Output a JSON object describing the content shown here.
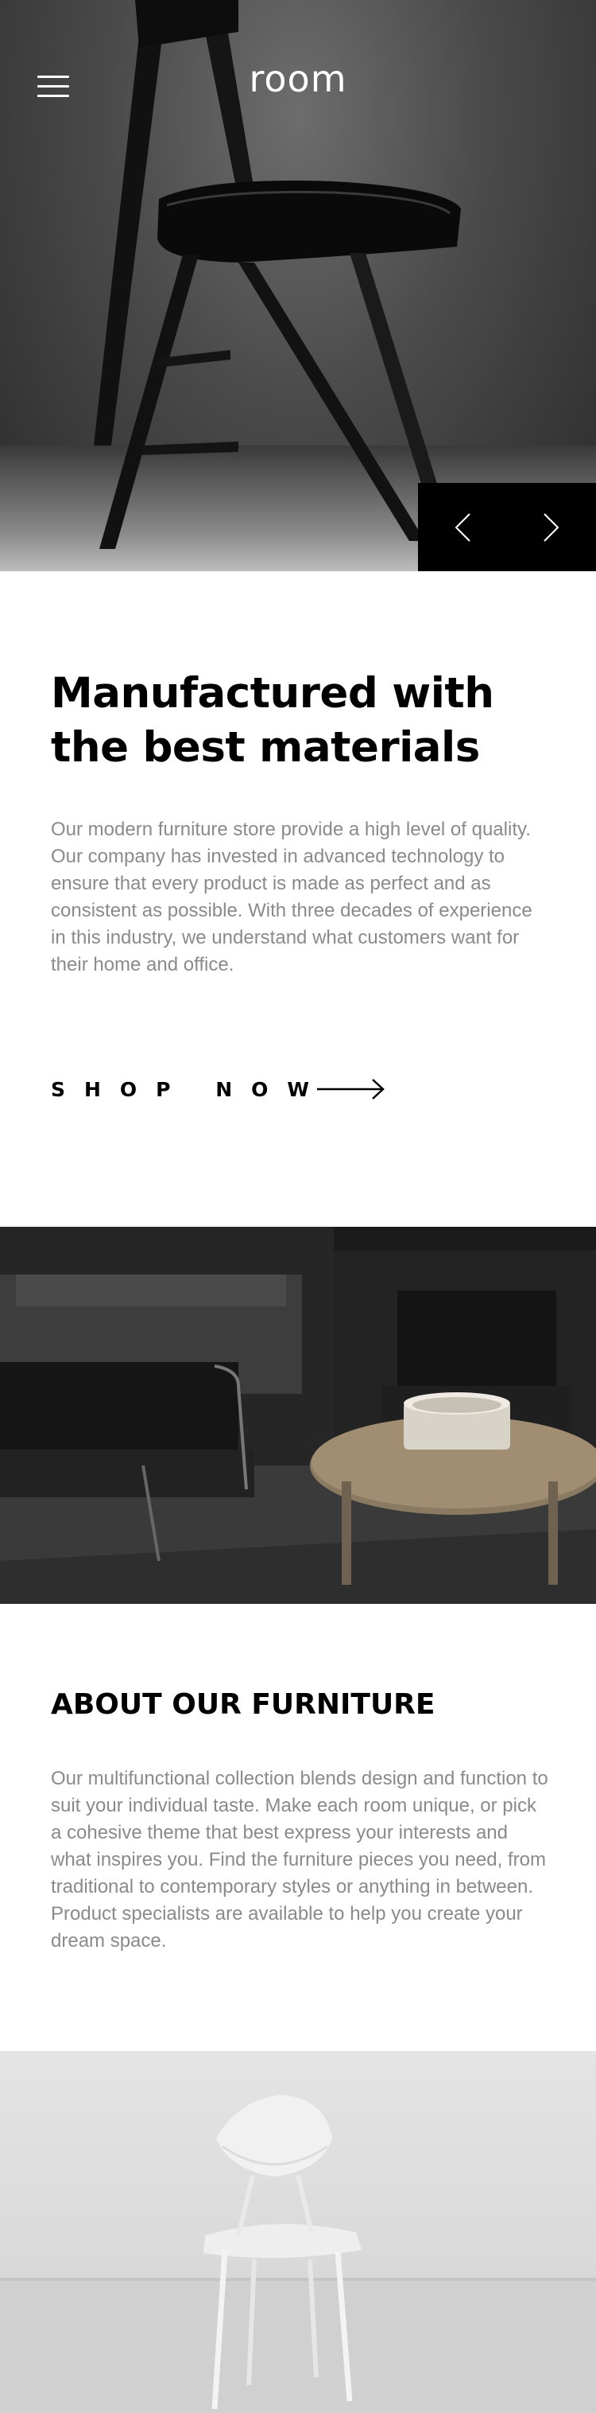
{
  "header": {
    "logo": "room",
    "menu_icon": "hamburger-menu-icon"
  },
  "hero": {
    "image_alt": "black folding chair",
    "prev_icon": "chevron-left-icon",
    "next_icon": "chevron-right-icon"
  },
  "intro": {
    "title": "Manufactured with the best materials",
    "body": "Our modern furniture store provide a high level of quality. Our company has invested in advanced technology to ensure that every product is made as perfect and as consistent as possible. With three decades of experience in this industry, we understand what customers want for their home and office.",
    "cta_label": "SHOP NOW",
    "cta_icon": "arrow-right-icon"
  },
  "about": {
    "title": "ABOUT OUR FURNITURE",
    "body": "Our multifunctional collection blends design and function to suit your individual taste. Make each room unique, or pick a cohesive theme that best express your interests and what inspires you. Find the furniture pieces you need, from traditional to contemporary styles or anything in between. Product specialists are available to help you create your dream space."
  },
  "colors": {
    "primary": "#000000",
    "body_text": "#8a8a8a",
    "background": "#ffffff"
  }
}
